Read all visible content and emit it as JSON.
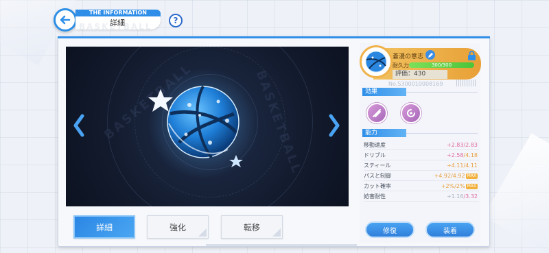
{
  "header": {
    "banner": "THE INFORMATION",
    "title": "詳細",
    "watermark": "BASKETBALL",
    "help": "?"
  },
  "display": {
    "watermark_left": "BASKETBALL",
    "watermark_right": "BASKETBALL"
  },
  "item": {
    "name": "蒼漫の意志",
    "durability_label": "耐久力",
    "durability_text": "300/300",
    "durability_fraction": 1.0,
    "rating": "評価：430",
    "serial": "No.S300010008169"
  },
  "sections": {
    "effects": "効果",
    "abilities": "能力"
  },
  "stats": [
    {
      "name": "移動速度",
      "bonus": "+2.83",
      "base": "/2.83",
      "max": false
    },
    {
      "name": "ドリブル",
      "bonus": "+2.58",
      "base": "/4.18",
      "max": false
    },
    {
      "name": "スティール",
      "bonus": "+4.11",
      "base": "/4.11",
      "max": false
    },
    {
      "name": "パスと制御",
      "bonus": "+4.92/4.92",
      "base": "",
      "max": true,
      "max_label": "MAX"
    },
    {
      "name": "カット確率",
      "bonus": "+2%/2%",
      "base": "",
      "max": true,
      "max_label": "MAX"
    },
    {
      "name": "妨害耐性",
      "bonus": "+1.16",
      "base": "/3.32",
      "max": false
    }
  ],
  "buttons": {
    "repair": "修復",
    "equip": "装着"
  },
  "tabs": [
    {
      "label": "詳細",
      "active": true
    },
    {
      "label": "強化",
      "active": false
    },
    {
      "label": "転移",
      "active": false
    }
  ],
  "colors": {
    "accent": "#2f8ee8",
    "gold": "#f0b24b",
    "effect": "#c585cf"
  }
}
